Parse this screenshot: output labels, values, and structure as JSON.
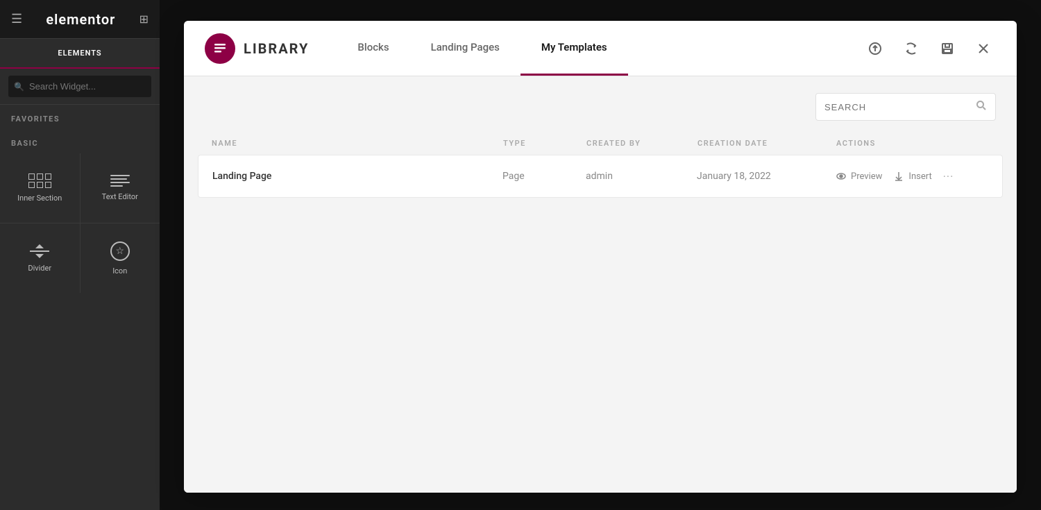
{
  "sidebar": {
    "logo": "elementor",
    "tabs": [
      {
        "label": "ELEMENTS",
        "active": true
      }
    ],
    "search_placeholder": "Search Widget...",
    "sections": [
      {
        "label": "FAVORITES",
        "widgets": []
      },
      {
        "label": "BASIC",
        "widgets": [
          {
            "id": "inner-section",
            "label": "Inner Section",
            "icon": "inner-section"
          },
          {
            "id": "text-editor",
            "label": "Text Editor",
            "icon": "text-editor"
          },
          {
            "id": "divider",
            "label": "Divider",
            "icon": "divider"
          },
          {
            "id": "icon",
            "label": "Icon",
            "icon": "icon-widget"
          }
        ]
      }
    ]
  },
  "library": {
    "title": "LIBRARY",
    "tabs": [
      {
        "label": "Blocks",
        "active": false
      },
      {
        "label": "Landing Pages",
        "active": false
      },
      {
        "label": "My Templates",
        "active": true
      }
    ],
    "search_placeholder": "SEARCH",
    "table": {
      "headers": [
        {
          "key": "name",
          "label": "NAME"
        },
        {
          "key": "type",
          "label": "TYPE"
        },
        {
          "key": "created_by",
          "label": "CREATED BY"
        },
        {
          "key": "creation_date",
          "label": "CREATION DATE"
        },
        {
          "key": "actions",
          "label": "ACTIONS"
        }
      ],
      "rows": [
        {
          "name": "Landing Page",
          "type": "Page",
          "created_by": "admin",
          "creation_date": "January 18, 2022",
          "actions": {
            "preview": "Preview",
            "insert": "Insert"
          }
        }
      ]
    }
  },
  "icons": {
    "upload": "↑",
    "sync": "↻",
    "save": "💾",
    "close": "✕",
    "search": "🔍",
    "preview_eye": "👁",
    "insert_arrow": "⬇",
    "more": "···"
  }
}
